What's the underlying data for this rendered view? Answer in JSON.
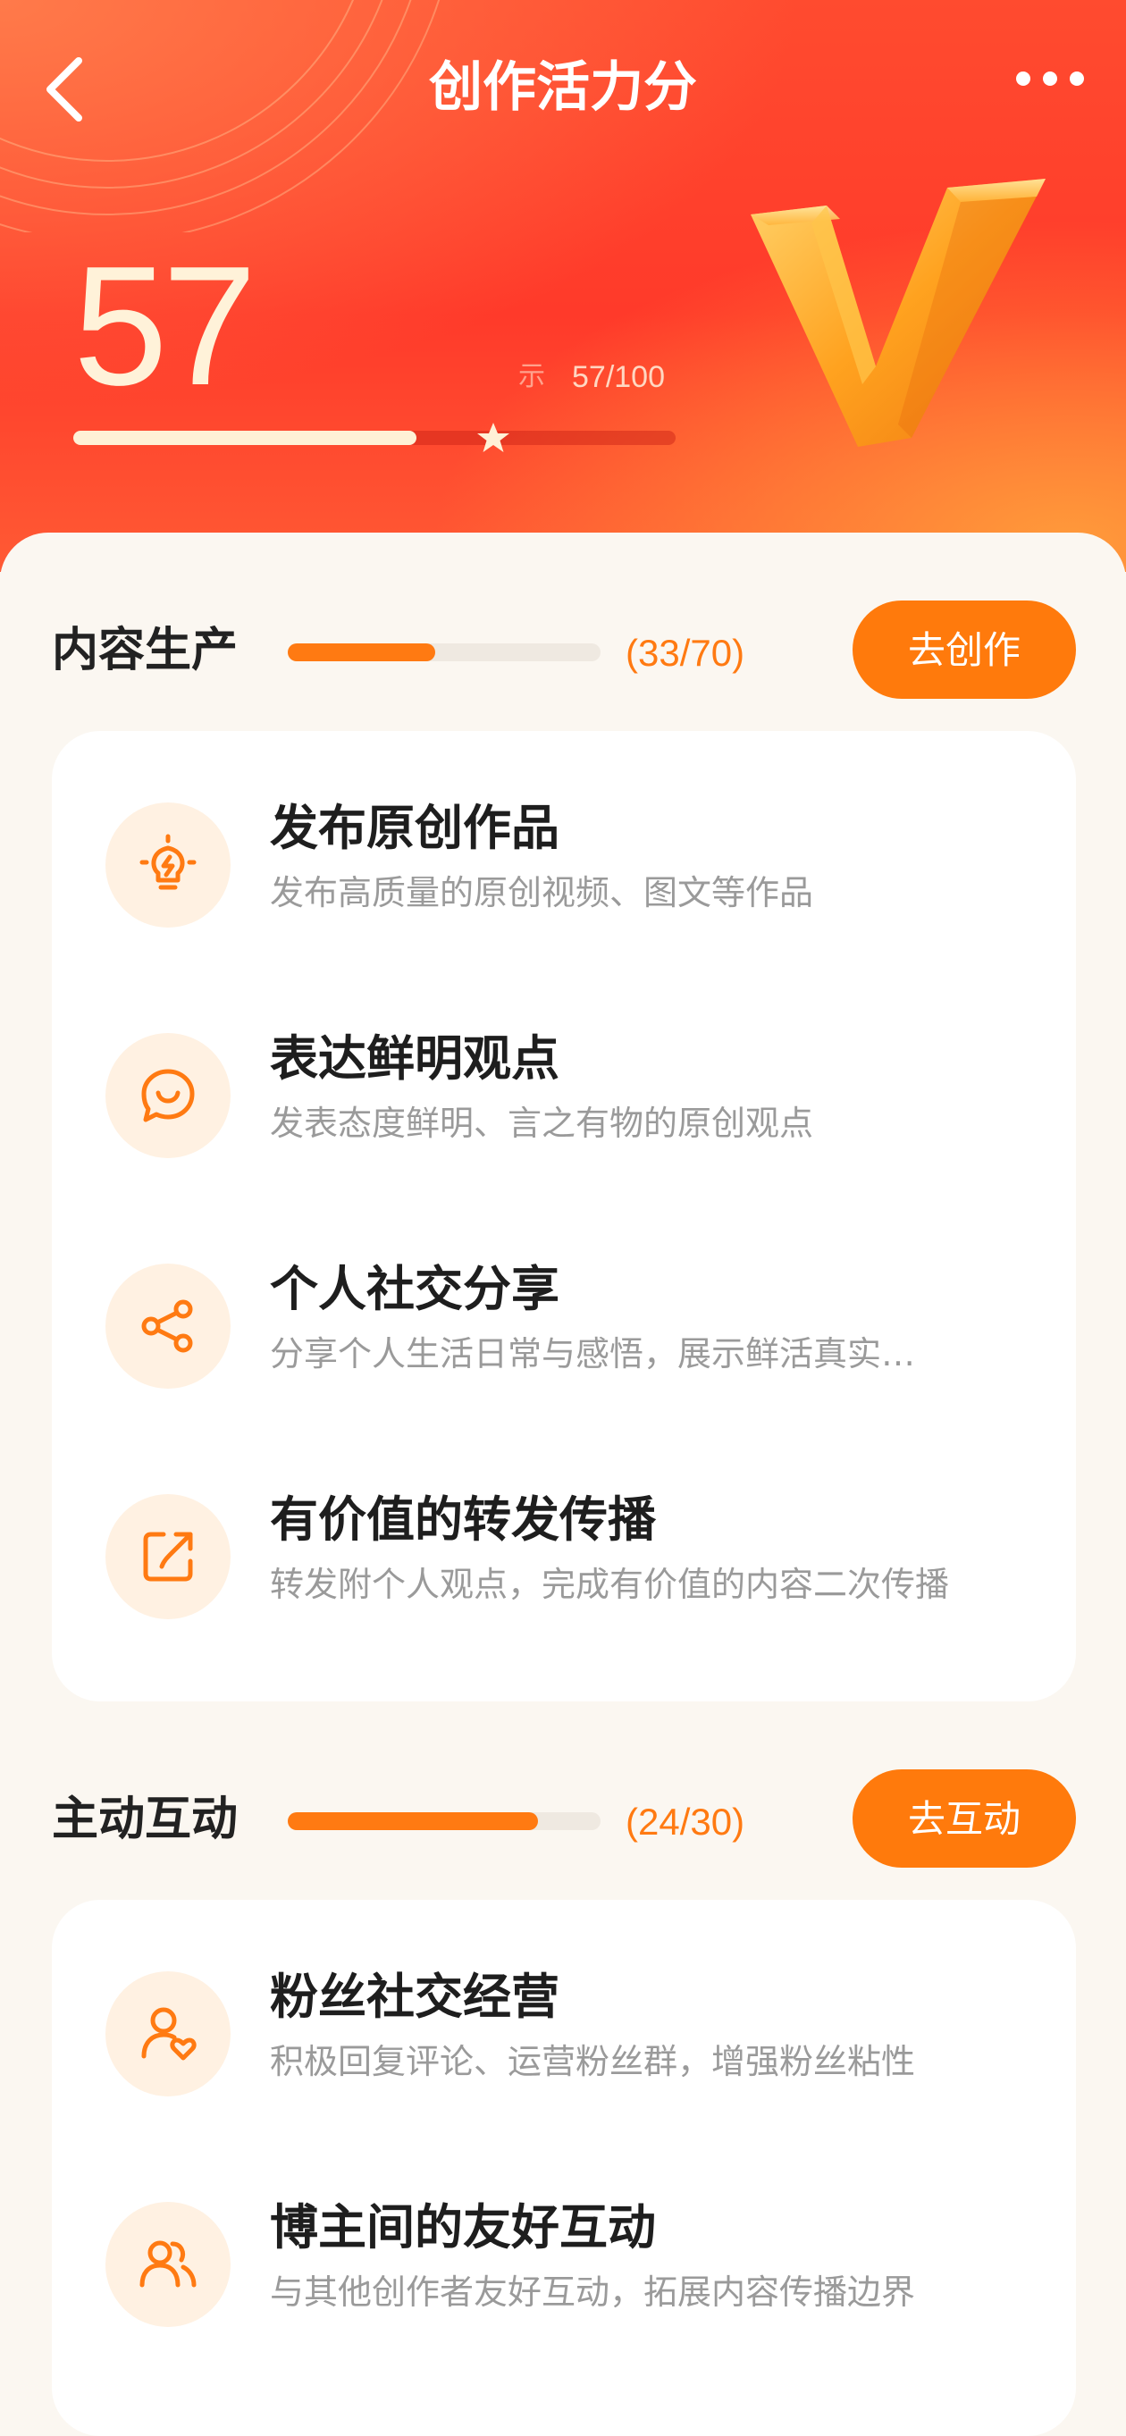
{
  "header": {
    "title": "创作活力分"
  },
  "score": {
    "value": "57",
    "label": "示",
    "ratio": "57/100",
    "progress": 0.57
  },
  "colors": {
    "accent": "#FF7A0C",
    "hero": "#FF3A2A"
  },
  "sections": [
    {
      "title": "内容生产",
      "progress_text": "(33/70)",
      "progress": 0.4714,
      "button": "去创作",
      "items": [
        {
          "icon": "lightbulb-icon",
          "title": "发布原创作品",
          "desc": "发布高质量的原创视频、图文等作品"
        },
        {
          "icon": "chat-smile-icon",
          "title": "表达鲜明观点",
          "desc": "发表态度鲜明、言之有物的原创观点"
        },
        {
          "icon": "share-icon",
          "title": "个人社交分享",
          "desc": "分享个人生活日常与感悟，展示鲜活真实…"
        },
        {
          "icon": "forward-icon",
          "title": "有价值的转发传播",
          "desc": "转发附个人观点，完成有价值的内容二次传播"
        }
      ]
    },
    {
      "title": "主动互动",
      "progress_text": "(24/30)",
      "progress": 0.8,
      "button": "去互动",
      "items": [
        {
          "icon": "user-heart-icon",
          "title": "粉丝社交经营",
          "desc": "积极回复评论、运营粉丝群，增强粉丝粘性"
        },
        {
          "icon": "users-icon",
          "title": "博主间的友好互动",
          "desc": "与其他创作者友好互动，拓展内容传播边界"
        }
      ]
    }
  ]
}
